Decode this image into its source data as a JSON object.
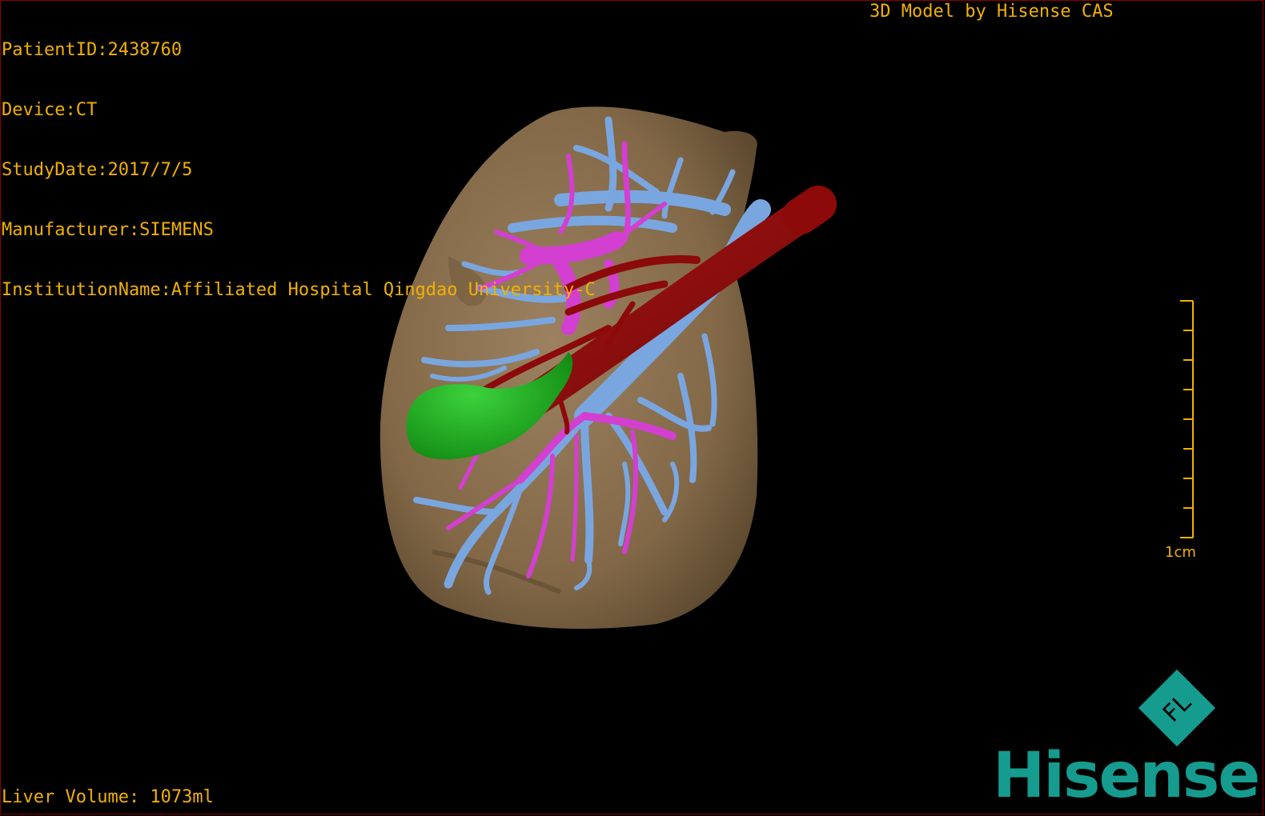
{
  "viewer": {
    "patient_line": "PatientID:2438760",
    "device_line": "Device:CT",
    "study_date_line": "StudyDate:2017/7/5",
    "manufacturer_line": "Manufacturer:SIEMENS",
    "institution_line": "InstitutionName:Affiliated Hospital Qingdao University-C",
    "credit_line": "3D Model by Hisense CAS",
    "liver_volume_line": "Liver Volume: 1073ml",
    "scale_label": "1cm"
  },
  "brand": {
    "logo_text": "Hisense",
    "logo_mark_letters": "FL",
    "color": "#169b8f"
  },
  "colors": {
    "overlay_text": "#f2b100",
    "liver": "#8b7150",
    "portal_vein": "#7aa6e0",
    "hepatic_vein": "#d33fd0",
    "artery": "#8c0a0a",
    "gallbladder": "#22aa22"
  }
}
